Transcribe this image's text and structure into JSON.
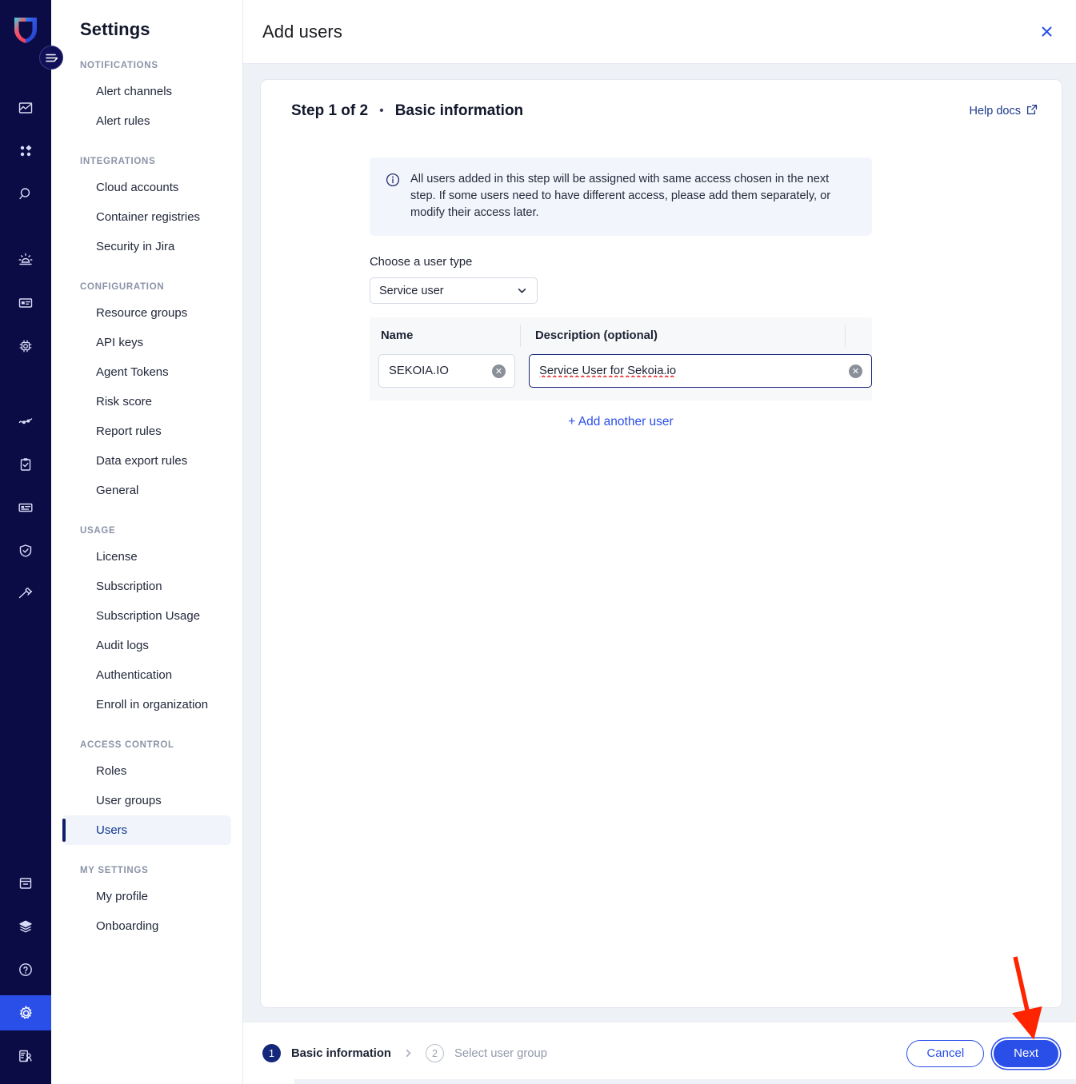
{
  "brand": {
    "logo_name": "sekoia-shield-logo"
  },
  "rail": {
    "toggle_label": "menu-toggle",
    "icons": [
      {
        "name": "intelligence-chart-icon"
      },
      {
        "name": "apps-grid-icon"
      },
      {
        "name": "search-icon"
      },
      {
        "name": "alert-siren-icon"
      },
      {
        "name": "asset-card-icon"
      },
      {
        "name": "chip-automation-icon"
      },
      {
        "name": "activity-graph-icon"
      },
      {
        "name": "clipboard-check-icon"
      },
      {
        "name": "id-card-icon"
      },
      {
        "name": "shield-check-icon"
      },
      {
        "name": "gavel-icon"
      }
    ],
    "bottom_icons": [
      {
        "name": "archive-box-icon"
      },
      {
        "name": "layers-stack-icon"
      },
      {
        "name": "help-circle-icon"
      },
      {
        "name": "gear-icon",
        "active": true
      },
      {
        "name": "user-profile-icon"
      }
    ]
  },
  "sidebar": {
    "title": "Settings",
    "sections": [
      {
        "label": "NOTIFICATIONS",
        "items": [
          {
            "label": "Alert channels",
            "active": false
          },
          {
            "label": "Alert rules",
            "active": false
          }
        ]
      },
      {
        "label": "INTEGRATIONS",
        "items": [
          {
            "label": "Cloud accounts",
            "active": false
          },
          {
            "label": "Container registries",
            "active": false
          },
          {
            "label": "Security in Jira",
            "active": false
          }
        ]
      },
      {
        "label": "CONFIGURATION",
        "items": [
          {
            "label": "Resource groups",
            "active": false
          },
          {
            "label": "API keys",
            "active": false
          },
          {
            "label": "Agent Tokens",
            "active": false
          },
          {
            "label": "Risk score",
            "active": false
          },
          {
            "label": "Report rules",
            "active": false
          },
          {
            "label": "Data export rules",
            "active": false
          },
          {
            "label": "General",
            "active": false
          }
        ]
      },
      {
        "label": "USAGE",
        "items": [
          {
            "label": "License",
            "active": false
          },
          {
            "label": "Subscription",
            "active": false
          },
          {
            "label": "Subscription Usage",
            "active": false
          },
          {
            "label": "Audit logs",
            "active": false
          },
          {
            "label": "Authentication",
            "active": false
          },
          {
            "label": "Enroll in organization",
            "active": false
          }
        ]
      },
      {
        "label": "ACCESS CONTROL",
        "items": [
          {
            "label": "Roles",
            "active": false
          },
          {
            "label": "User groups",
            "active": false
          },
          {
            "label": "Users",
            "active": true
          }
        ]
      },
      {
        "label": "MY SETTINGS",
        "items": [
          {
            "label": "My profile",
            "active": false
          },
          {
            "label": "Onboarding",
            "active": false
          }
        ]
      }
    ]
  },
  "panel": {
    "title": "Add users",
    "close_icon": "close-icon"
  },
  "card": {
    "step_counter": "Step 1 of 2",
    "separator": "•",
    "step_name": "Basic information",
    "help_docs": "Help docs",
    "help_docs_icon": "external-link-icon",
    "info_icon": "info-circle-icon",
    "info_text": "All users added in this step will be assigned with same access chosen in the next step. If some users need to have different access, please add them separately, or modify their access later.",
    "user_type_label": "Choose a user type",
    "user_type_value": "Service user",
    "user_type_options": [
      "Service user"
    ],
    "table": {
      "columns": [
        "Name",
        "Description (optional)"
      ],
      "rows": [
        {
          "name": "SEKOIA.IO",
          "name_placeholder": "Name",
          "description": "Service User for Sekoia.io",
          "description_placeholder": "Description (optional)"
        }
      ]
    },
    "add_another": "+ Add another user"
  },
  "footer": {
    "steps": [
      {
        "num": "1",
        "label": "Basic information",
        "active": true
      },
      {
        "num": "2",
        "label": "Select user group",
        "active": false
      }
    ],
    "cancel": "Cancel",
    "next": "Next"
  },
  "colors": {
    "accent_blue": "#2a4fe8",
    "rail_navy": "#0b0b45",
    "panel_bg": "#eef2f7",
    "annotation_red": "#ff2400",
    "active_nav_text": "#11338f"
  }
}
